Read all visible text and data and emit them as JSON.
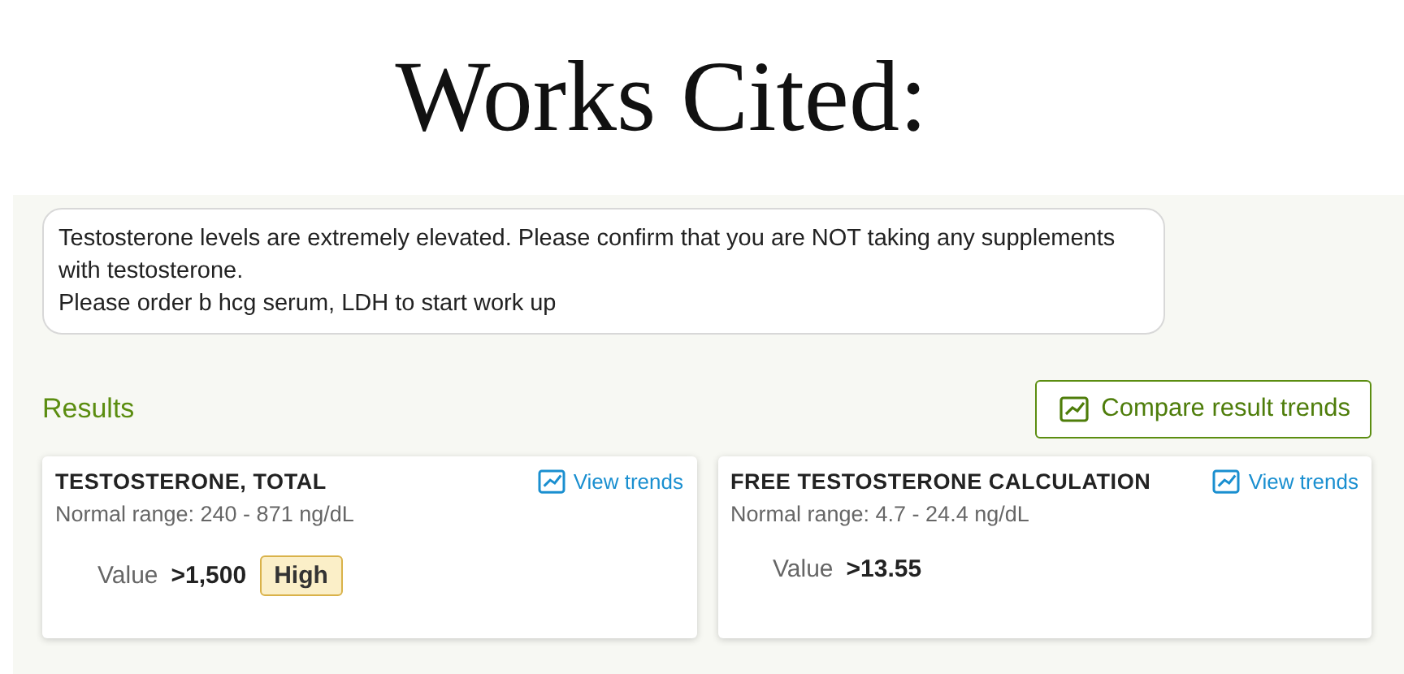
{
  "heading": "Works Cited:",
  "message": {
    "lines": [
      "Testosterone levels are extremely elevated. Please confirm that you are NOT taking any supplements with testosterone.",
      "Please order b hcg serum, LDH to start work up"
    ]
  },
  "results": {
    "title": "Results",
    "compare_button": "Compare result trends",
    "cards": [
      {
        "name": "TESTOSTERONE, TOTAL",
        "trends_link": "View trends",
        "range": "Normal range: 240 - 871 ng/dL",
        "value_label": "Value",
        "value": ">1,500",
        "flag": "High"
      },
      {
        "name": "FREE TESTOSTERONE CALCULATION",
        "trends_link": "View trends",
        "range": "Normal range: 4.7 - 24.4 ng/dL",
        "value_label": "Value",
        "value": ">13.55"
      }
    ]
  }
}
